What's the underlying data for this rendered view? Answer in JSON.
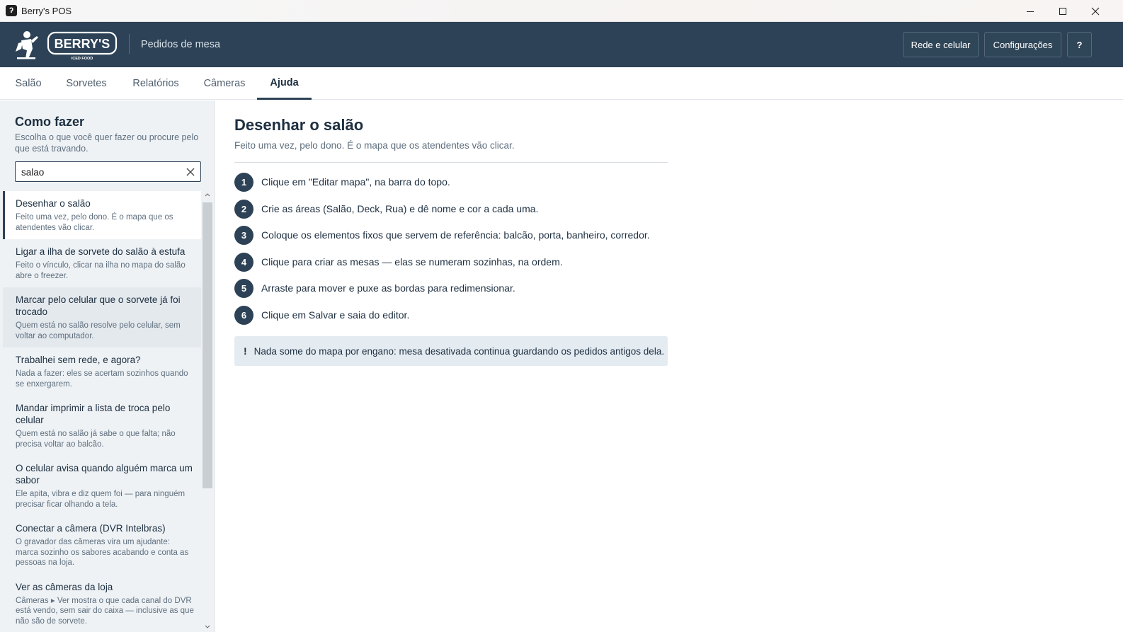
{
  "window": {
    "title": "Berry's POS"
  },
  "header": {
    "logo_text": "BERRY'S",
    "logo_tagline": "ICED FOOD",
    "subtitle": "Pedidos de mesa",
    "buttons": {
      "network": "Rede e celular",
      "settings": "Configurações",
      "help": "?"
    }
  },
  "tabs": [
    {
      "label": "Salão",
      "active": false
    },
    {
      "label": "Sorvetes",
      "active": false
    },
    {
      "label": "Relatórios",
      "active": false
    },
    {
      "label": "Câmeras",
      "active": false
    },
    {
      "label": "Ajuda",
      "active": true
    }
  ],
  "sidebar": {
    "title": "Como fazer",
    "description": "Escolha o que você quer fazer ou procure pelo que está travando.",
    "search": {
      "value": "salao"
    },
    "items": [
      {
        "title": "Desenhar o salão",
        "desc": "Feito uma vez, pelo dono. É o mapa que os atendentes vão clicar."
      },
      {
        "title": "Ligar a ilha de sorvete do salão à estufa",
        "desc": "Feito o vínculo, clicar na ilha no mapa do salão abre o freezer."
      },
      {
        "title": "Marcar pelo celular que o sorvete já foi trocado",
        "desc": "Quem está no salão resolve pelo celular, sem voltar ao computador."
      },
      {
        "title": "Trabalhei sem rede, e agora?",
        "desc": "Nada a fazer: eles se acertam sozinhos quando se enxergarem."
      },
      {
        "title": "Mandar imprimir a lista de troca pelo celular",
        "desc": "Quem está no salão já sabe o que falta; não precisa voltar ao balcão."
      },
      {
        "title": "O celular avisa quando alguém marca um sabor",
        "desc": "Ele apita, vibra e diz quem foi — para ninguém precisar ficar olhando a tela."
      },
      {
        "title": "Conectar a câmera (DVR Intelbras)",
        "desc": "O gravador das câmeras vira um ajudante: marca sozinho os sabores acabando e conta as pessoas na loja."
      },
      {
        "title": "Ver as câmeras da loja",
        "desc": "Câmeras ▸ Ver mostra o que cada canal do DVR está vendo, sem sair do caixa — inclusive as que não são de sorvete."
      }
    ]
  },
  "article": {
    "title": "Desenhar o salão",
    "subtitle": "Feito uma vez, pelo dono. É o mapa que os atendentes vão clicar.",
    "steps": [
      {
        "num": "1",
        "text": "Clique em \"Editar mapa\", na barra do topo."
      },
      {
        "num": "2",
        "text": "Crie as áreas (Salão, Deck, Rua) e dê nome e cor a cada uma."
      },
      {
        "num": "3",
        "text": "Coloque os elementos fixos que servem de referência: balcão, porta, banheiro, corredor."
      },
      {
        "num": "4",
        "text": "Clique para criar as mesas — elas se numeram sozinhas, na ordem."
      },
      {
        "num": "5",
        "text": "Arraste para mover e puxe as bordas para redimensionar."
      },
      {
        "num": "6",
        "text": "Clique em Salvar e saia do editor."
      }
    ],
    "note": {
      "icon": "!",
      "text": "Nada some do mapa por engano: mesa desativada continua guardando os pedidos antigos dela."
    }
  },
  "colors": {
    "header_bg": "#2d4256",
    "sidebar_bg": "#eef2f5",
    "note_bg": "#e4ebf1"
  }
}
